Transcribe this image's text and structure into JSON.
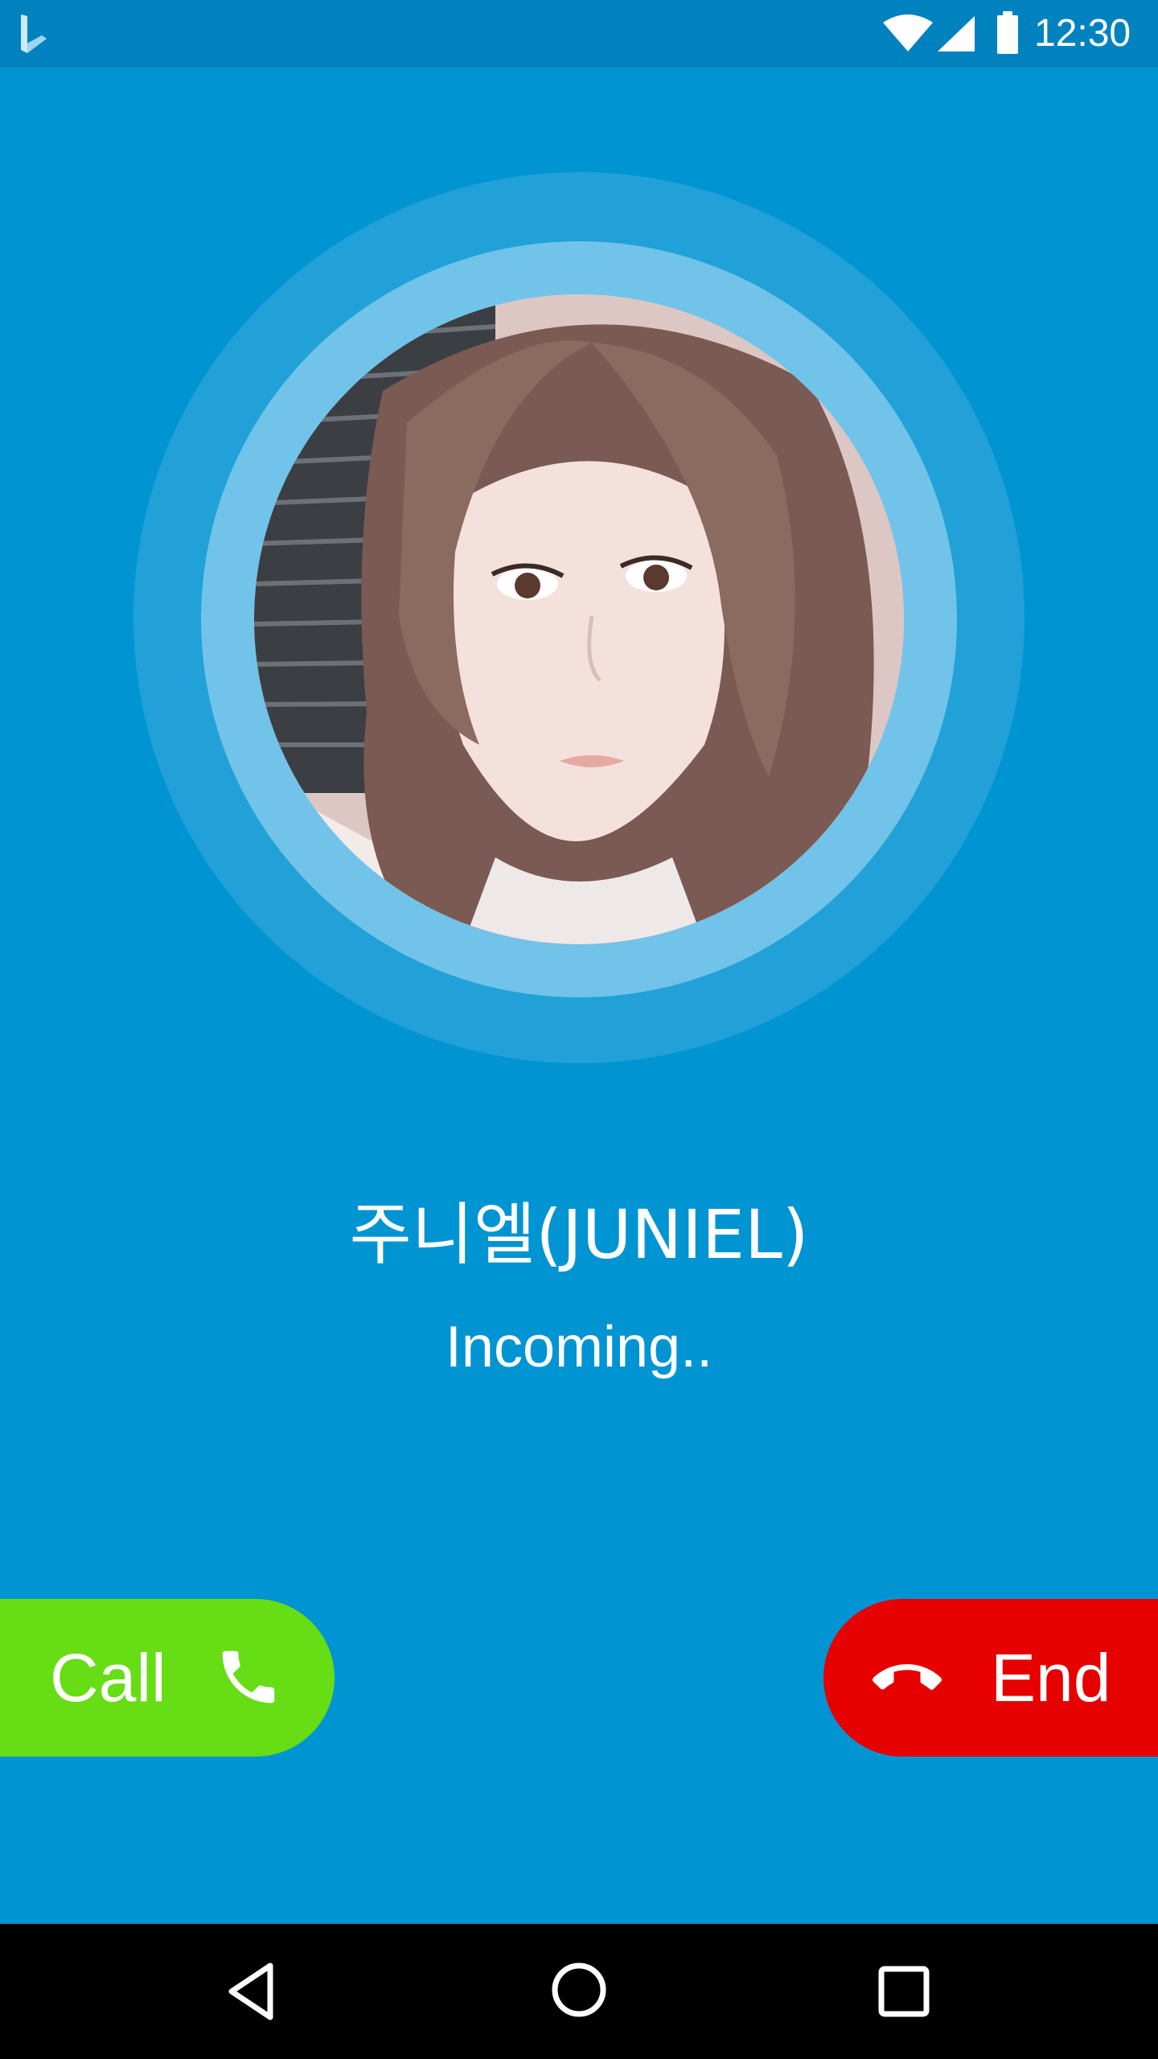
{
  "status_bar": {
    "time": "12:30",
    "icons": [
      "app-logo-icon",
      "wifi-icon",
      "cell-signal-icon",
      "battery-icon"
    ]
  },
  "caller": {
    "name": "주니엘(JUNIEL)",
    "status": "Incoming.."
  },
  "actions": {
    "call_label": "Call",
    "call_icon": "phone-icon",
    "end_label": "End",
    "end_icon": "hang-up-icon"
  },
  "nav": {
    "icons": [
      "back-icon",
      "home-icon",
      "recents-icon"
    ]
  },
  "colors": {
    "background": "#0094d3",
    "status_bar": "#0082bf",
    "outer_ring": "#21a1d8",
    "inner_ring": "#72c3e9",
    "call_button": "#66dd14",
    "end_button": "#e60000",
    "nav_bar": "#000000"
  }
}
